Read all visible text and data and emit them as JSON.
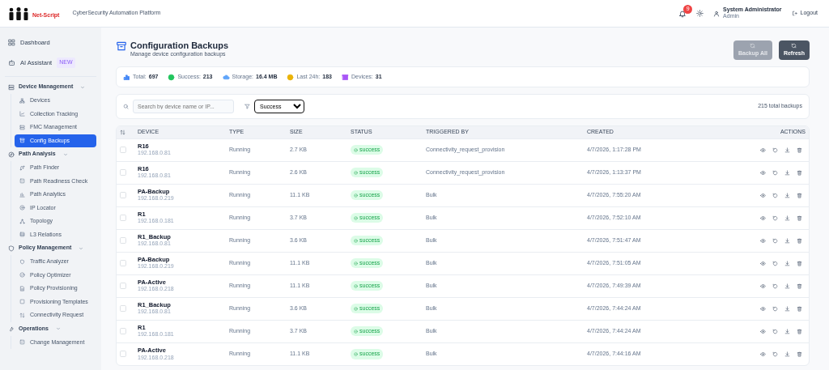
{
  "header": {
    "logo_text": "Net-Script",
    "subtitle": "CyberSecurity Automation Platform",
    "notification_count": "9",
    "user_name": "System Administrator",
    "user_role": "Admin",
    "logout": "Logout"
  },
  "sidebar": {
    "items": [
      {
        "label": "Dashboard",
        "kind": "top",
        "selected": false
      },
      {
        "label": "AI Assistant",
        "kind": "top",
        "badge": "NEW",
        "selected": false
      },
      {
        "label": "Device Management",
        "kind": "section",
        "expanded": true,
        "children": [
          {
            "label": "Devices",
            "selected": false
          },
          {
            "label": "Collection Tracking",
            "selected": false
          },
          {
            "label": "FMC Management",
            "selected": false
          },
          {
            "label": "Config Backups",
            "selected": true
          }
        ]
      },
      {
        "label": "Path Analysis",
        "kind": "section",
        "expanded": true,
        "children": [
          {
            "label": "Path Finder",
            "selected": false
          },
          {
            "label": "Path Readiness Check",
            "selected": false
          },
          {
            "label": "Path Analytics",
            "selected": false
          },
          {
            "label": "IP Locator",
            "selected": false
          },
          {
            "label": "Topology",
            "selected": false
          },
          {
            "label": "L3 Relations",
            "selected": false
          }
        ]
      },
      {
        "label": "Policy Management",
        "kind": "section",
        "expanded": true,
        "children": [
          {
            "label": "Traffic Analyzer",
            "selected": false
          },
          {
            "label": "Policy Optimizer",
            "selected": false
          },
          {
            "label": "Policy Provisioning",
            "selected": false
          },
          {
            "label": "Provisioning Templates",
            "selected": false
          },
          {
            "label": "Connectivity Request",
            "selected": false
          }
        ]
      },
      {
        "label": "Operations",
        "kind": "section",
        "expanded": true,
        "children": [
          {
            "label": "Change Management",
            "selected": false
          }
        ]
      }
    ]
  },
  "page": {
    "title": "Configuration Backups",
    "subtitle": "Manage device configuration backups",
    "buttons": [
      {
        "label": "Backup All",
        "disabled": true
      },
      {
        "label": "Refresh",
        "disabled": false
      }
    ]
  },
  "stats": [
    {
      "label": "Total:",
      "value": "697",
      "color": "#3b82f6"
    },
    {
      "label": "Success:",
      "value": "213",
      "color": "#22c55e"
    },
    {
      "label": "Storage:",
      "value": "16.4 MB",
      "color": "#60a5fa"
    },
    {
      "label": "Last 24h:",
      "value": "183",
      "color": "#eab308"
    },
    {
      "label": "Devices:",
      "value": "31",
      "color": "#a855f7"
    }
  ],
  "filters": {
    "search_placeholder": "Search by device name or IP...",
    "status_filter": "Success",
    "total": "215 total backups"
  },
  "table": {
    "columns": [
      "DEVICE",
      "TYPE",
      "SIZE",
      "STATUS",
      "TRIGGERED BY",
      "CREATED",
      "ACTIONS"
    ],
    "rows": [
      {
        "device": "R16",
        "ip": "192.168.0.81",
        "type": "Running",
        "size": "2.7 KB",
        "status": "success",
        "triggered_by": "Connectivity_request_provision",
        "created": "4/7/2026, 1:17:28 PM",
        "checked": false
      },
      {
        "device": "R16",
        "ip": "192.168.0.81",
        "type": "Running",
        "size": "2.6 KB",
        "status": "success",
        "triggered_by": "Connectivity_request_provision",
        "created": "4/7/2026, 1:13:37 PM",
        "checked": false
      },
      {
        "device": "PA-Backup",
        "ip": "192.168.0.219",
        "type": "Running",
        "size": "11.1 KB",
        "status": "success",
        "triggered_by": "Bulk",
        "created": "4/7/2026, 7:55:20 AM",
        "checked": false
      },
      {
        "device": "R1",
        "ip": "192.168.0.181",
        "type": "Running",
        "size": "3.7 KB",
        "status": "success",
        "triggered_by": "Bulk",
        "created": "4/7/2026, 7:52:10 AM",
        "checked": false
      },
      {
        "device": "R1_Backup",
        "ip": "192.168.0.81",
        "type": "Running",
        "size": "3.6 KB",
        "status": "success",
        "triggered_by": "Bulk",
        "created": "4/7/2026, 7:51:47 AM",
        "checked": false
      },
      {
        "device": "PA-Backup",
        "ip": "192.168.0.219",
        "type": "Running",
        "size": "11.1 KB",
        "status": "success",
        "triggered_by": "Bulk",
        "created": "4/7/2026, 7:51:05 AM",
        "checked": false
      },
      {
        "device": "PA-Active",
        "ip": "192.168.0.218",
        "type": "Running",
        "size": "11.1 KB",
        "status": "success",
        "triggered_by": "Bulk",
        "created": "4/7/2026, 7:49:39 AM",
        "checked": false
      },
      {
        "device": "R1_Backup",
        "ip": "192.168.0.81",
        "type": "Running",
        "size": "3.6 KB",
        "status": "success",
        "triggered_by": "Bulk",
        "created": "4/7/2026, 7:44:24 AM",
        "checked": false
      },
      {
        "device": "R1",
        "ip": "192.168.0.181",
        "type": "Running",
        "size": "3.7 KB",
        "status": "success",
        "triggered_by": "Bulk",
        "created": "4/7/2026, 7:44:24 AM",
        "checked": false
      },
      {
        "device": "PA-Active",
        "ip": "192.168.0.218",
        "type": "Running",
        "size": "11.1 KB",
        "status": "success",
        "triggered_by": "Bulk",
        "created": "4/7/2026, 7:44:16 AM",
        "checked": false
      }
    ]
  }
}
